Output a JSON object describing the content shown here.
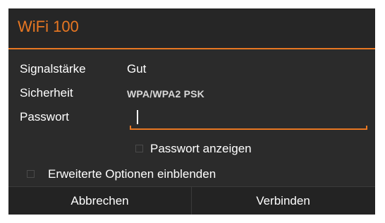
{
  "dialog": {
    "title": "WiFi 100",
    "rows": [
      {
        "label": "Signalstärke",
        "value": "Gut"
      },
      {
        "label": "Sicherheit",
        "value": "WPA/WPA2 PSK"
      },
      {
        "label": "Passwort",
        "value": ""
      }
    ],
    "show_password_label": "Passwort anzeigen",
    "advanced_options_label": "Erweiterte Optionen einblenden",
    "cancel_label": "Abbrechen",
    "connect_label": "Verbinden",
    "accent_color": "#e87722"
  }
}
